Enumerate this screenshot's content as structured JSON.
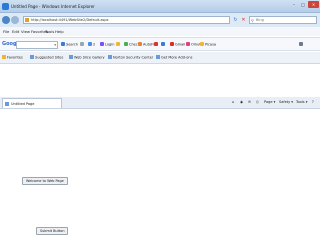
{
  "window": {
    "title": "Untitled Page - Windows Internet Explorer",
    "minimize_glyph": "–",
    "maximize_glyph": "□",
    "close_glyph": "✕"
  },
  "address": {
    "url": "http://localhost:4491/WebSite2/Default.aspx",
    "refresh_glyph": "↻",
    "stop_glyph": "✕"
  },
  "search": {
    "placeholder": "Bing"
  },
  "menu": [
    "File",
    "Edit",
    "View",
    "Favorites",
    "Tools",
    "Help"
  ],
  "google_toolbar": {
    "logo": "Google",
    "dropdown_glyph": "▾",
    "items": [
      {
        "label": "Search",
        "icon": "search-icon",
        "color": "#3a7bd5"
      },
      {
        "label": "",
        "icon": "dropdown-icon",
        "color": "#9aa5b2"
      },
      {
        "label": "2",
        "icon": "popup-blocker-icon",
        "color": "#4a90e2"
      },
      {
        "label": "Login",
        "icon": "user-icon",
        "color": "#7c4dff"
      },
      {
        "label": "",
        "icon": "star-icon",
        "color": "#f2b533"
      },
      {
        "label": "Check",
        "icon": "check-icon",
        "color": "#4caf50"
      },
      {
        "label": "AutoFill",
        "icon": "autofill-icon",
        "color": "#e0843a"
      },
      {
        "label": "",
        "icon": "share-icon",
        "color": "#d33"
      },
      {
        "label": "",
        "icon": "sidewiki-icon",
        "color": "#3a7bd5"
      },
      {
        "label": "Gmail",
        "icon": "gmail-icon",
        "color": "#d93025"
      },
      {
        "label": "Orkut",
        "icon": "orkut-icon",
        "color": "#e2407a"
      },
      {
        "label": "Picasa",
        "icon": "picasa-icon",
        "color": "#f2b533"
      },
      {
        "label": "Options",
        "icon": "wrench-icon",
        "color": "#6c7a89"
      }
    ]
  },
  "favorites_bar": {
    "items": [
      {
        "label": "Favorites",
        "icon": "star"
      },
      {
        "label": "Suggested Sites",
        "icon": "page"
      },
      {
        "label": "Web Slice Gallery",
        "icon": "page"
      },
      {
        "label": "Norton Security Center",
        "icon": "page"
      },
      {
        "label": "Get More Add-ons",
        "icon": "page"
      }
    ]
  },
  "tab": {
    "label": "Untitled Page"
  },
  "command_bar": [
    "Page ▾",
    "Safety ▾",
    "Tools ▾",
    "?"
  ],
  "page": {
    "welcome_button": "Welcome to Web Page",
    "bottom_button": "Submit Button"
  }
}
